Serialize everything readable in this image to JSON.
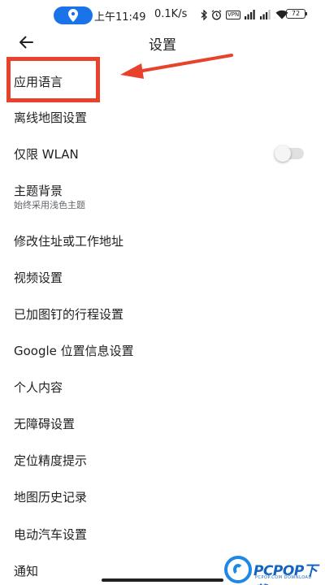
{
  "status_bar": {
    "time": "上午11:49",
    "net_speed": "0.1K/s",
    "vpn_label": "VPN",
    "battery": "72"
  },
  "header": {
    "title": "设置"
  },
  "settings": {
    "app_language": "应用语言",
    "offline_maps": "离线地图设置",
    "wifi_only": "仅限 WLAN",
    "wifi_only_toggle": "off",
    "theme": "主题背景",
    "theme_sub": "始终采用浅色主题",
    "edit_home_work": "修改住址或工作地址",
    "video_settings": "视频设置",
    "pinned_trips": "已加图钉的行程设置",
    "google_location": "Google 位置信息设置",
    "personal_content": "个人内容",
    "accessibility": "无障碍设置",
    "location_accuracy": "定位精度提示",
    "maps_history": "地图历史记录",
    "ev_settings": "电动汽车设置",
    "notifications": "通知"
  },
  "watermark": {
    "brand": "PCPOP下载",
    "sub": "PCPOP.COM DOWNLOAD"
  },
  "colors": {
    "annotation": "#e8412c",
    "accent": "#1a73e8",
    "watermark": "#1e88e5"
  }
}
